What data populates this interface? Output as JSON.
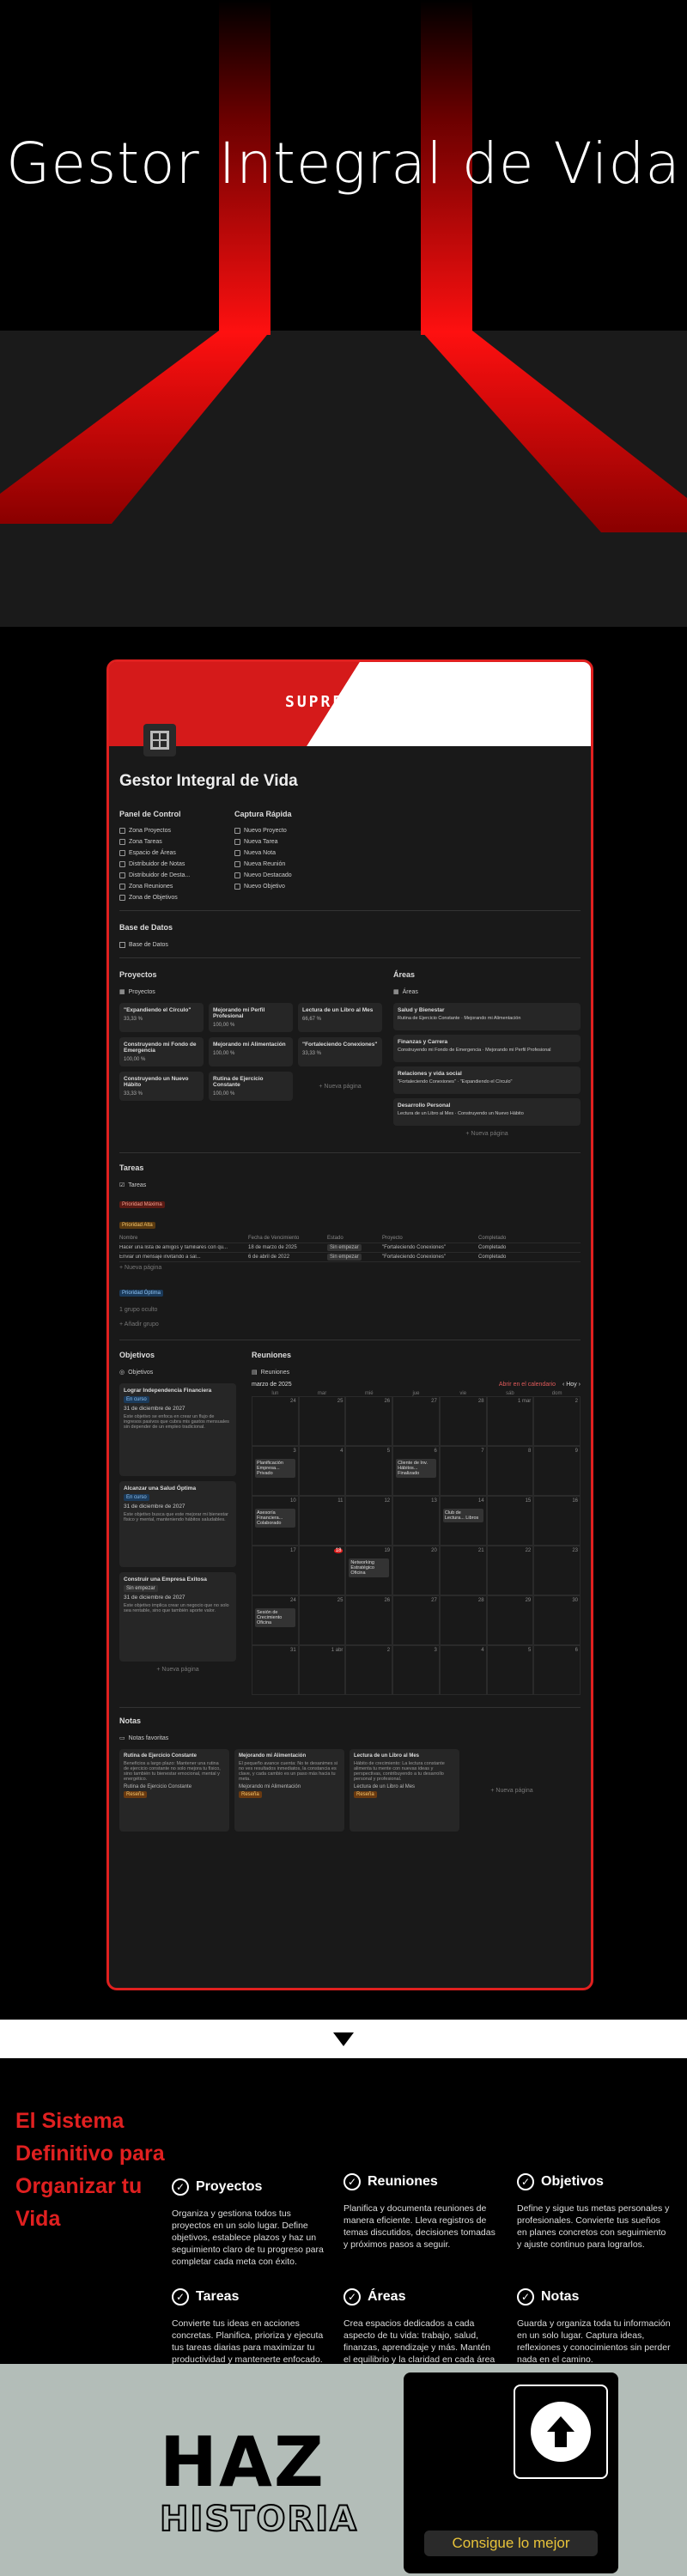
{
  "hero": {
    "title": "Gestor Integral de Vida"
  },
  "app": {
    "logo": "SUPREMO",
    "title": "Gestor Integral de Vida",
    "control_panel": {
      "title": "Panel de Control",
      "items": [
        "Zona Proyectos",
        "Zona Tareas",
        "Espacio de Áreas",
        "Distribuidor de Notas",
        "Distribuidor de Desta...",
        "Zona Reuniones",
        "Zona de Objetivos"
      ]
    },
    "quick_capture": {
      "title": "Captura Rápida",
      "items": [
        "Nuevo Proyecto",
        "Nueva Tarea",
        "Nueva Nota",
        "Nueva Reunión",
        "Nuevo Destacado",
        "Nuevo Objetivo"
      ]
    },
    "database": {
      "title": "Base de Datos",
      "link": "Base de Datos"
    },
    "projects": {
      "title": "Proyectos",
      "db": "Proyectos",
      "cards": [
        {
          "name": "\"Expandiendo el Círculo\"",
          "pct": "33,33 %"
        },
        {
          "name": "Mejorando mi Perfil Profesional",
          "pct": "100,00 %"
        },
        {
          "name": "Lectura de un Libro al Mes",
          "pct": "66,67 %"
        },
        {
          "name": "Construyendo mi Fondo de Emergencia",
          "pct": "100,00 %"
        },
        {
          "name": "Mejorando mi Alimentación",
          "pct": "100,00 %"
        },
        {
          "name": "\"Fortaleciendo Conexiones\"",
          "pct": "33,33 %"
        },
        {
          "name": "Construyendo un Nuevo Hábito",
          "pct": "33,33 %"
        },
        {
          "name": "Rutina de Ejercicio Constante",
          "pct": "100,00 %"
        }
      ],
      "new_page": "+ Nueva página"
    },
    "areas": {
      "title": "Áreas",
      "db": "Áreas",
      "cards": [
        {
          "name": "Salud y Bienestar",
          "links": "Rutina de Ejercicio Constante · Mejorando mi Alimentación"
        },
        {
          "name": "Finanzas y Carrera",
          "links": "Construyendo mi Fondo de Emergencia · Mejorando mi Perfil Profesional"
        },
        {
          "name": "Relaciones y vida social",
          "links": "\"Fortaleciendo Conexiones\" · \"Expandiendo el Círculo\""
        },
        {
          "name": "Desarrollo Personal",
          "links": "Lectura de un Libro al Mes · Construyendo un Nuevo Hábito"
        }
      ],
      "new_page": "+ Nueva página"
    },
    "tasks": {
      "title": "Tareas",
      "db": "Tareas",
      "priority_max": "Prioridad Máxima",
      "priority_high": "Prioridad Alta",
      "priority_optimal": "Prioridad Óptima",
      "columns": [
        "Nombre",
        "Fecha de Vencimiento",
        "Estado",
        "Proyecto",
        "Completado"
      ],
      "rows": [
        {
          "name": "Hacer una lista de amigos y familiares con qu...",
          "date": "18 de marzo de 2025",
          "state": "Sin empezar",
          "project": "\"Fortaleciendo Conexiones\"",
          "done": "Completado"
        },
        {
          "name": "Enviar un mensaje invitando a sal...",
          "date": "6 de abril de 2022",
          "state": "Sin empezar",
          "project": "\"Fortaleciendo Conexiones\"",
          "done": "Completado"
        }
      ],
      "new_page": "+ Nueva página",
      "hidden_group": "1 grupo oculto",
      "add_group": "+ Añadir grupo"
    },
    "objectives": {
      "title": "Objetivos",
      "db": "Objetivos",
      "cards": [
        {
          "name": "Lograr Independencia Financiera",
          "status": "En curso",
          "date": "31 de diciembre de 2027",
          "desc": "Este objetivo se enfoca en crear un flujo de ingresos pasivos que cubra mis gastos mensuales sin depender de un empleo tradicional."
        },
        {
          "name": "Alcanzar una Salud Óptima",
          "status": "En curso",
          "date": "31 de diciembre de 2027",
          "desc": "Este objetivo busca que este mejorar mi bienestar físico y mental, manteniendo hábitos saludables."
        },
        {
          "name": "Construir una Empresa Exitosa",
          "status": "Sin empezar",
          "date": "31 de diciembre de 2027",
          "desc": "Este objetivo implica crear un negocio que no solo sea rentable, sino que también aporte valor."
        }
      ],
      "new_page": "+ Nueva página"
    },
    "meetings": {
      "title": "Reuniones",
      "db": "Reuniones",
      "month": "marzo de 2025",
      "open_calendar": "Abrir en el calendario",
      "today": "Hoy",
      "weekdays": [
        "lun",
        "mar",
        "mié",
        "jue",
        "vie",
        "sáb",
        "dom"
      ],
      "days": [
        "24",
        "25",
        "26",
        "27",
        "28",
        "1 mar",
        "2",
        "3",
        "4",
        "5",
        "6",
        "7",
        "8",
        "9",
        "10",
        "11",
        "12",
        "13",
        "14",
        "15",
        "16",
        "17",
        "18",
        "19",
        "20",
        "21",
        "22",
        "23",
        "24",
        "25",
        "26",
        "27",
        "28",
        "29",
        "30",
        "31",
        "1 abr",
        "2",
        "3",
        "4",
        "5",
        "6"
      ],
      "events": [
        {
          "day_index": 7,
          "text": "Planificación Empresa... Privado"
        },
        {
          "day_index": 10,
          "text": "Cliente de Inv. Hábitos... Finalizado"
        },
        {
          "day_index": 14,
          "text": "Asesoría Financiera... Colaborado"
        },
        {
          "day_index": 18,
          "text": "Club de Lectura... Libros"
        },
        {
          "day_index": 23,
          "text": "Networking Estratégico Oficina"
        },
        {
          "day_index": 28,
          "text": "Sesión de Crecimiento Oficina"
        }
      ],
      "highlight_day": "18"
    },
    "notes": {
      "title": "Notas",
      "db": "Notas favoritas",
      "cards": [
        {
          "name": "Rutina de Ejercicio Constante",
          "desc": "Beneficios a largo plazo: Mantener una rutina de ejercicio constante no solo mejora tu físico, sino también tu bienestar emocional, mental y energético.",
          "link": "Rutina de Ejercicio Constante",
          "tag": "Reseña"
        },
        {
          "name": "Mejorando mi Alimentación",
          "desc": "El pequeño avance cuenta: No te desanimes si no ves resultados inmediatos, la constancia es clave, y cada cambio es un paso más hacia tu meta.",
          "link": "Mejorando mi Alimentación",
          "tag": "Reseña"
        },
        {
          "name": "Lectura de un Libro al Mes",
          "desc": "Hábito de crecimiento: La lectura constante alimenta tu mente con nuevas ideas y perspectivas, contribuyendo a tu desarrollo personal y profesional.",
          "link": "Lectura de un Libro al Mes",
          "tag": "Reseña"
        }
      ],
      "new_page": "+ Nueva página"
    }
  },
  "features": {
    "heading": "El Sistema Definitivo para Organizar tu Vida",
    "items": [
      {
        "title": "Proyectos",
        "desc": "Organiza y gestiona todos tus proyectos en un solo lugar. Define objetivos, establece plazos y haz un seguimiento claro de tu progreso para completar cada meta con éxito."
      },
      {
        "title": "Reuniones",
        "desc": "Planifica y documenta reuniones de manera eficiente. Lleva registros de temas discutidos, decisiones tomadas y próximos pasos a seguir."
      },
      {
        "title": "Objetivos",
        "desc": "Define y sigue tus metas personales y profesionales. Convierte tus sueños en planes concretos con seguimiento y ajuste continuo para lograrlos."
      },
      {
        "title": "Tareas",
        "desc": "Convierte tus ideas en acciones concretas. Planifica, prioriza y ejecuta tus tareas diarias para maximizar tu productividad y mantenerte enfocado."
      },
      {
        "title": "Áreas",
        "desc": "Crea espacios dedicados a cada aspecto de tu vida: trabajo, salud, finanzas, aprendizaje y más. Mantén el equilibrio y la claridad en cada área importante."
      },
      {
        "title": "Notas",
        "desc": "Guarda y organiza toda tu información en un solo lugar. Captura ideas, reflexiones y conocimientos sin perder nada en el camino."
      }
    ]
  },
  "cta": {
    "haz": "HAZ",
    "historia": "HISTORIA",
    "button": "Consigue lo mejor"
  },
  "colors": {
    "accent": "#e0201f",
    "dark": "#191919",
    "cta_bg": "#b3bdb8",
    "cta_btn_text": "#e8c33a"
  }
}
